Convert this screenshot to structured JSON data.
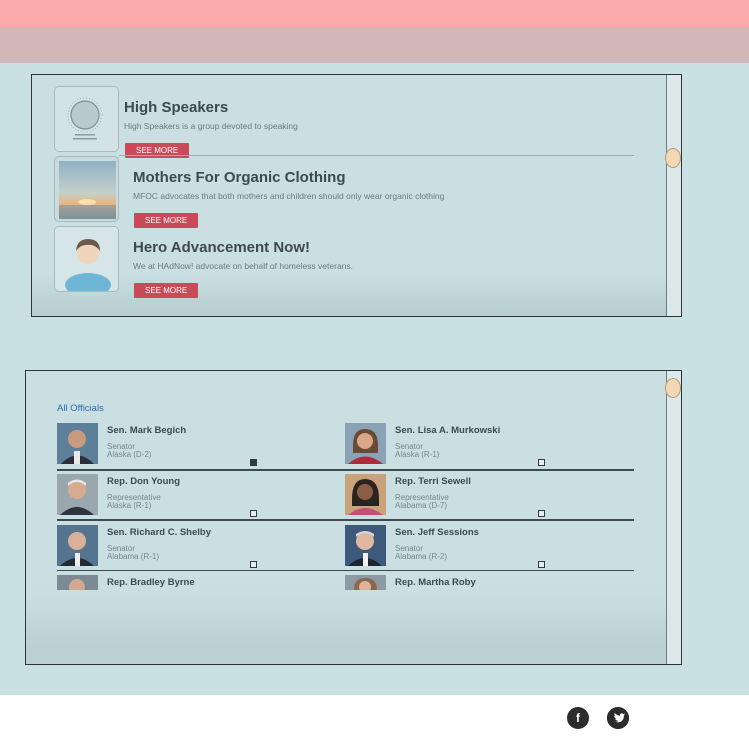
{
  "organizations": [
    {
      "name": "High Speakers",
      "description": "High Speakers is a group devoted to speaking",
      "button": "SEE MORE"
    },
    {
      "name": "Mothers For Organic Clothing",
      "description": "MFOC advocates that both mothers and children should only wear organic clothing",
      "button": "SEE MORE"
    },
    {
      "name": "Hero Advancement Now!",
      "description": "We at HAdNow! advocate on behalf of homeless veterans.",
      "button": "SEE MORE"
    }
  ],
  "officials": {
    "heading": "All Officials",
    "list": [
      {
        "name": "Sen. Mark Begich",
        "title": "Senator",
        "district": "Alaska (D-2)",
        "checked": true
      },
      {
        "name": "Sen. Lisa A. Murkowski",
        "title": "Senator",
        "district": "Alaska (R-1)",
        "checked": false
      },
      {
        "name": "Rep. Don Young",
        "title": "Representative",
        "district": "Alaska (R-1)",
        "checked": false
      },
      {
        "name": "Rep. Terri Sewell",
        "title": "Representative",
        "district": "Alabama (D-7)",
        "checked": false
      },
      {
        "name": "Sen. Richard C. Shelby",
        "title": "Senator",
        "district": "Alabama (R-1)",
        "checked": false
      },
      {
        "name": "Sen. Jeff Sessions",
        "title": "Senator",
        "district": "Alabama (R-2)",
        "checked": false
      },
      {
        "name": "Rep. Bradley Byrne",
        "title": "",
        "district": "",
        "checked": false
      },
      {
        "name": "Rep. Martha Roby",
        "title": "",
        "district": "",
        "checked": false
      }
    ]
  },
  "footer": {
    "social": [
      {
        "icon": "facebook-icon",
        "glyph": "f"
      },
      {
        "icon": "twitter-icon",
        "glyph": "t"
      }
    ]
  },
  "colors": {
    "header_top": "#fca9a9",
    "header_bottom": "#d2b7b8",
    "accent_button": "#c94a58",
    "background": "#c9e1e3",
    "link": "#2a6cb0"
  }
}
